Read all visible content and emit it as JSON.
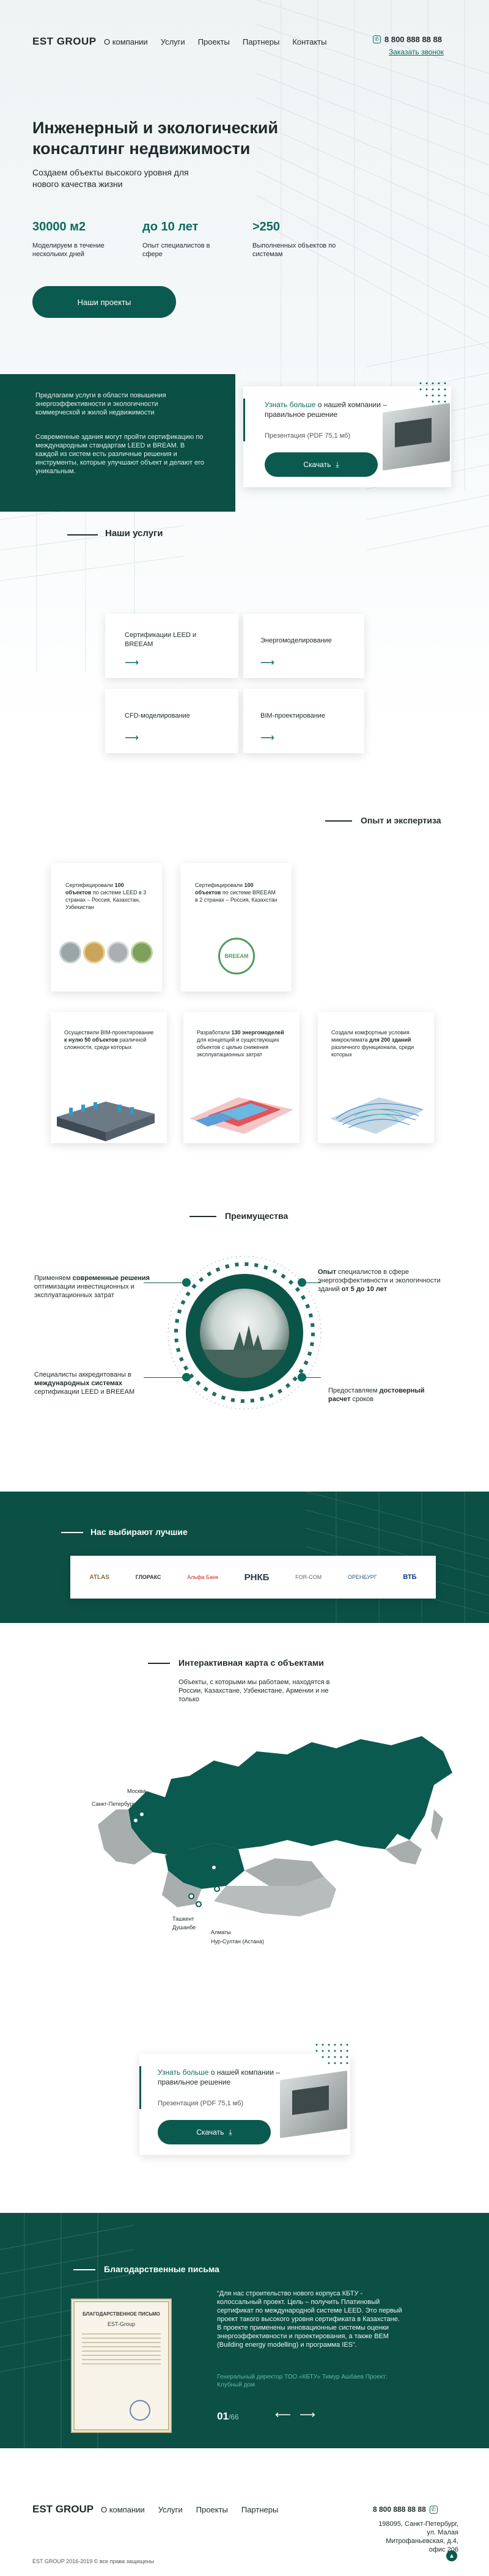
{
  "header": {
    "logo": "EST GROUP",
    "nav": [
      "О компании",
      "Услуги",
      "Проекты",
      "Партнеры",
      "Контакты"
    ],
    "phone": "8 800 888 88 88",
    "callback": "Заказать звонок"
  },
  "hero": {
    "title": "Инженерный и экологический консалтинг недвижимости",
    "subtitle": "Создаем объекты высокого уровня для нового качества жизни",
    "stats": [
      {
        "value": "30000 м2",
        "label": "Моделируем в течение нескольких дней"
      },
      {
        "value": "до 10 лет",
        "label": "Опыт специалистов в сфере"
      },
      {
        "value": ">250",
        "label": "Выполненных объектов по системам"
      }
    ],
    "cta": "Наши проекты"
  },
  "intro": {
    "text1": "Предлагаем услуги в области повышения энергоэффективности и экологичности коммерческой и жилой недвижимости",
    "text2": "Современные здания могут пройти сертификацию по международным стандартам LEED и BREAM. В каждой из систем есть различные решения и инструменты, которые улучшают объект и делают его уникальным.",
    "download": {
      "title_prefix": "Узнать больше",
      "title_rest": " о нашей компании – правильное решение",
      "file": "Презентация (PDF 75,1 мб)",
      "button": "Скачать"
    }
  },
  "services": {
    "title": "Наши услуги",
    "items": [
      "Сертификации LEED и BREEAM",
      "Энергомоделирование",
      "CFD-моделирование",
      "BIM-проектирование"
    ]
  },
  "experience": {
    "title": "Опыт и экспертиза",
    "cards": [
      {
        "pre": "Сертифицировали ",
        "bold": "100 объектов",
        "post": " по системе LEED в 3 странах – Россия, Казахстан, Узбекистан"
      },
      {
        "pre": "Сертифицировали ",
        "bold": "100 объектов",
        "post": " по системе BREEAM в 2 странах – Россия, Казахстан"
      },
      {
        "pre": "Осуществили BIM-проектирование ",
        "bold": "к нулю 50 объектов",
        "post": " различной сложности, среди которых"
      },
      {
        "pre": "Разработали ",
        "bold": "130 энергомоделей",
        "post": " для концепций и существующих объектов с целью снижения эксплуатационных затрат"
      },
      {
        "pre": "Создали комфортные условия микроклимата ",
        "bold": "для 200 зданий",
        "post": " различного функционала, среди которых"
      }
    ],
    "badge_text": "BREEAM"
  },
  "advantages": {
    "title": "Преимущества",
    "left1_pre": "Применяем ",
    "left1_bold": "современные решения",
    "left1_post": " оптимизации инвестиционных и эксплуатационных затрат",
    "left2_pre": "Специалисты аккредитованы в ",
    "left2_bold": "международных системах",
    "left2_post": " сертификации LEED и BREEAM",
    "right1_bold": "Опыт",
    "right1_post": " специалистов в сфере энергоэффективности и экологичности зданий ",
    "right1_bold2": "от 5 до 10 лет",
    "right2_pre": "Предоставляем ",
    "right2_bold": "достоверный расчет",
    "right2_post": " сроков"
  },
  "partners": {
    "title": "Нас выбирают лучшие",
    "logos": [
      "ATLAS",
      "ГЛОРАКС",
      "Альфа Банк",
      "РНКБ",
      "FOR-COM",
      "ОРЕНБУРГ",
      "ВТБ"
    ]
  },
  "map": {
    "title": "Интерактивная карта с объектами",
    "desc": "Объекты, с которыми мы работаем, находятся в России, Казахстане, Узбекистане, Армении и не только",
    "cities": [
      "Москва",
      "Санкт-Петербург",
      "Ташкент",
      "Душанбе",
      "Алматы",
      "Нур-Султан (Астана)"
    ]
  },
  "download2": {
    "title_prefix": "Узнать больше",
    "title_rest": " о нашей компании – правильное решение",
    "file": "Презентация (PDF 75,1 мб)",
    "button": "Скачать"
  },
  "letters": {
    "title": "Благодарственные письма",
    "letter_heading": "БЛАГОДАРСТВЕННОЕ ПИСЬМО",
    "letter_company": "EST-Group",
    "quote": "“Для нас строительство нового корпуса КБТУ - колоссальный проект. Цель – получить Платиновый сертификат по международной системе LEED. Это первый проект такого высокого уровня сертификата в Казахстане. В проекте применены инновационные системы оценки энергоэффективности и проектирования, а также BEM (Building energy modelling) и программа IES”.",
    "author": "Генеральный директор ТОО «КБТУ» Тимур Ашбаев Проект: Клубный дом",
    "counter": "01",
    "total": "/66"
  },
  "footer": {
    "logo": "EST GROUP",
    "nav": [
      "О компании",
      "Услуги",
      "Проекты",
      "Партнеры"
    ],
    "phone": "8 800 888 88 88",
    "address": "198095, Санкт-Петербург, ул. Малая Митрофаньевская, д.4, офис 206",
    "copyright": "EST GROUP 2016-2019 © все права защищены"
  },
  "colors": {
    "accent": "#0b5a4f",
    "dark": "#0b4f45",
    "text": "#1f2a2a"
  }
}
